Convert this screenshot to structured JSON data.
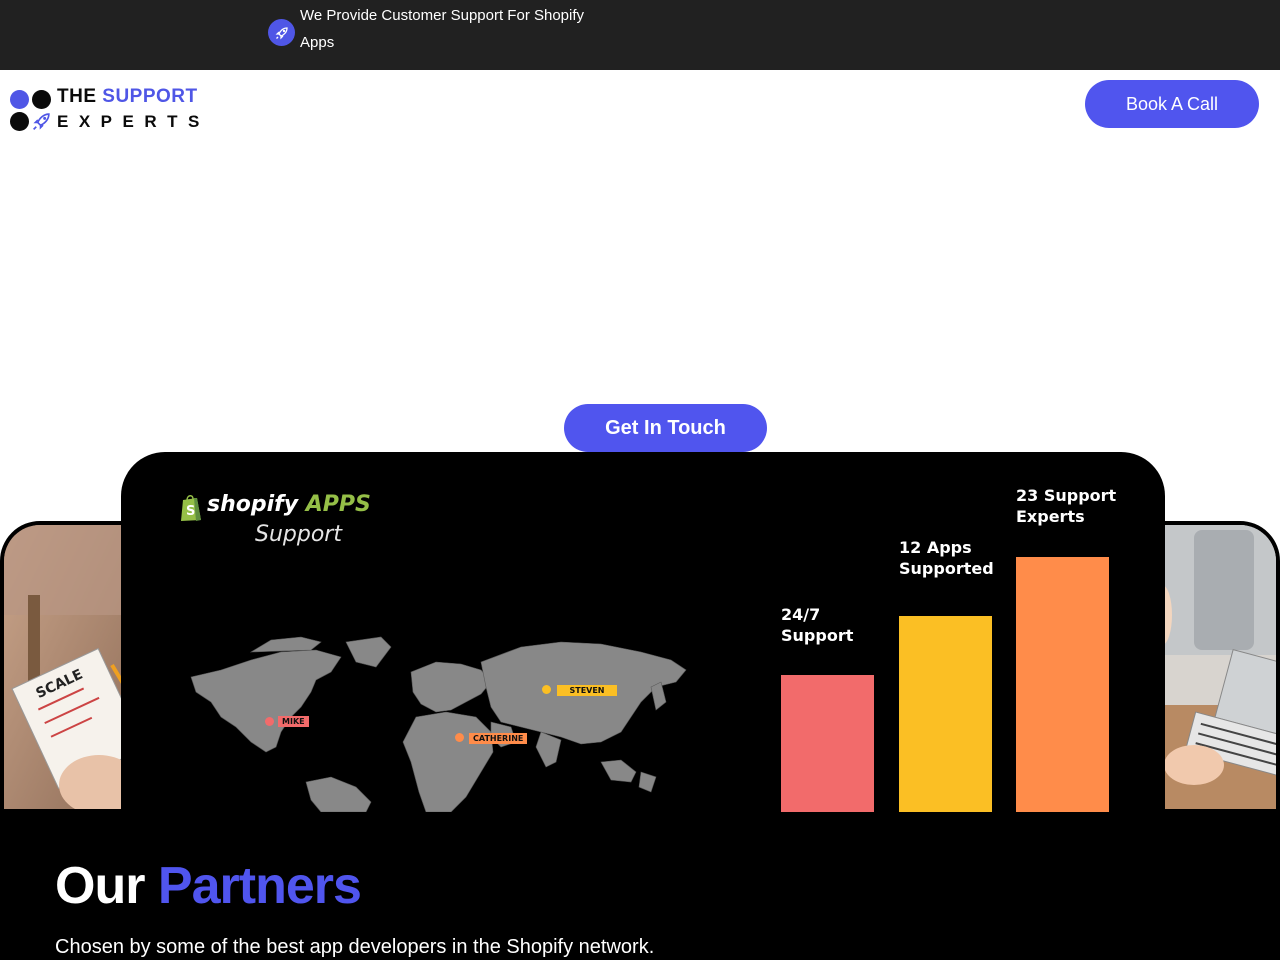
{
  "announcement": {
    "text": "We Provide Customer Support For Shopify Apps",
    "icon": "rocket-icon"
  },
  "header": {
    "logo_line1_a": "THE",
    "logo_line1_b": "SUPPORT",
    "logo_line2": "EXPERTS",
    "book_label": "Book A Call"
  },
  "hero": {
    "cta_label": "Get In Touch"
  },
  "showcase": {
    "brand_word": "shopify",
    "brand_apps": "APPS",
    "brand_sub": "Support",
    "map_pins": [
      {
        "name": "MIKE",
        "color": "#f26b6b"
      },
      {
        "name": "STEVEN",
        "color": "#fbbf24"
      },
      {
        "name": "CATHERINE",
        "color": "#ff8c4a"
      }
    ],
    "chart_data": {
      "type": "bar",
      "categories": [
        "24/7 Support",
        "12 Apps Supported",
        "23 Support Experts"
      ],
      "labels": [
        "24/7\nSupport",
        "12 Apps\nSupported",
        "23 Support\nExperts"
      ],
      "values": [
        24,
        12,
        23
      ],
      "colors": [
        "#f26b6b",
        "#fbbf24",
        "#ff8c4a"
      ],
      "title": "",
      "xlabel": "",
      "ylabel": ""
    }
  },
  "partners": {
    "title_a": "Our",
    "title_b": "Partners",
    "subtitle": "Chosen by some of the best app developers in the Shopify network."
  },
  "colors": {
    "accent": "#5055ee",
    "dark": "#212121",
    "shopify_green": "#95bf47"
  }
}
